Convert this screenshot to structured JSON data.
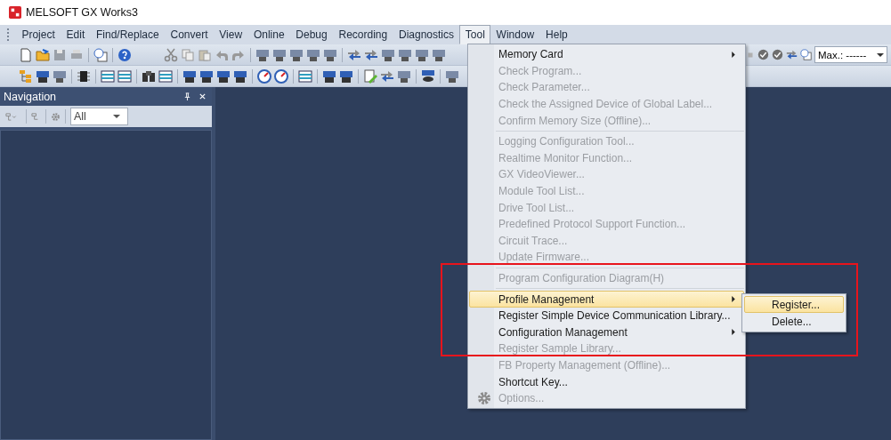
{
  "window": {
    "title": "MELSOFT GX Works3"
  },
  "menu_bar": [
    {
      "label": "Project",
      "selected": false
    },
    {
      "label": "Edit",
      "selected": false
    },
    {
      "label": "Find/Replace",
      "selected": false
    },
    {
      "label": "Convert",
      "selected": false
    },
    {
      "label": "View",
      "selected": false
    },
    {
      "label": "Online",
      "selected": false
    },
    {
      "label": "Debug",
      "selected": false
    },
    {
      "label": "Recording",
      "selected": false
    },
    {
      "label": "Diagnostics",
      "selected": false
    },
    {
      "label": "Tool",
      "selected": true
    },
    {
      "label": "Window",
      "selected": false
    },
    {
      "label": "Help",
      "selected": false
    }
  ],
  "toolbar": {
    "monitor_field": {
      "value": "Max.: ------"
    }
  },
  "navigation": {
    "title": "Navigation",
    "filter": {
      "value": "All"
    }
  },
  "tool_menu": {
    "items": [
      {
        "label": "Memory Card",
        "disabled": false,
        "submenu": true,
        "selected": false,
        "separator_before": false,
        "icon": false
      },
      {
        "label": "Check Program...",
        "disabled": true,
        "submenu": false,
        "selected": false,
        "separator_before": false,
        "icon": false
      },
      {
        "label": "Check Parameter...",
        "disabled": true,
        "submenu": false,
        "selected": false,
        "separator_before": false,
        "icon": false
      },
      {
        "label": "Check the Assigned Device of Global Label...",
        "disabled": true,
        "submenu": false,
        "selected": false,
        "separator_before": false,
        "icon": false
      },
      {
        "label": "Confirm Memory Size (Offline)...",
        "disabled": true,
        "submenu": false,
        "selected": false,
        "separator_before": false,
        "icon": false
      },
      {
        "label": "Logging Configuration Tool...",
        "disabled": true,
        "submenu": false,
        "selected": false,
        "separator_before": true,
        "icon": false
      },
      {
        "label": "Realtime Monitor Function...",
        "disabled": true,
        "submenu": false,
        "selected": false,
        "separator_before": false,
        "icon": false
      },
      {
        "label": "GX VideoViewer...",
        "disabled": true,
        "submenu": false,
        "selected": false,
        "separator_before": false,
        "icon": false
      },
      {
        "label": "Module Tool List...",
        "disabled": true,
        "submenu": false,
        "selected": false,
        "separator_before": false,
        "icon": false
      },
      {
        "label": "Drive Tool List...",
        "disabled": true,
        "submenu": false,
        "selected": false,
        "separator_before": false,
        "icon": false
      },
      {
        "label": "Predefined Protocol Support Function...",
        "disabled": true,
        "submenu": false,
        "selected": false,
        "separator_before": false,
        "icon": false
      },
      {
        "label": "Circuit Trace...",
        "disabled": true,
        "submenu": false,
        "selected": false,
        "separator_before": false,
        "icon": false
      },
      {
        "label": "Update Firmware...",
        "disabled": true,
        "submenu": false,
        "selected": false,
        "separator_before": false,
        "icon": false
      },
      {
        "label": "Program Configuration Diagram(H)",
        "disabled": true,
        "submenu": false,
        "selected": false,
        "separator_before": true,
        "icon": false
      },
      {
        "label": "Profile Management",
        "disabled": false,
        "submenu": true,
        "selected": true,
        "separator_before": true,
        "icon": false
      },
      {
        "label": "Register Simple Device Communication Library...",
        "disabled": false,
        "submenu": false,
        "selected": false,
        "separator_before": false,
        "icon": false
      },
      {
        "label": "Configuration Management",
        "disabled": false,
        "submenu": true,
        "selected": false,
        "separator_before": false,
        "icon": false
      },
      {
        "label": "Register Sample Library...",
        "disabled": true,
        "submenu": false,
        "selected": false,
        "separator_before": false,
        "icon": false
      },
      {
        "label": "FB Property Management (Offline)...",
        "disabled": true,
        "submenu": false,
        "selected": false,
        "separator_before": false,
        "icon": false
      },
      {
        "label": "Shortcut Key...",
        "disabled": false,
        "submenu": false,
        "selected": false,
        "separator_before": false,
        "icon": false
      },
      {
        "label": "Options...",
        "disabled": true,
        "submenu": false,
        "selected": false,
        "separator_before": false,
        "icon": true
      }
    ]
  },
  "submenu": {
    "items": [
      {
        "label": "Register...",
        "selected": true
      },
      {
        "label": "Delete...",
        "selected": false
      }
    ]
  },
  "annotation": {
    "kind": "frame"
  }
}
